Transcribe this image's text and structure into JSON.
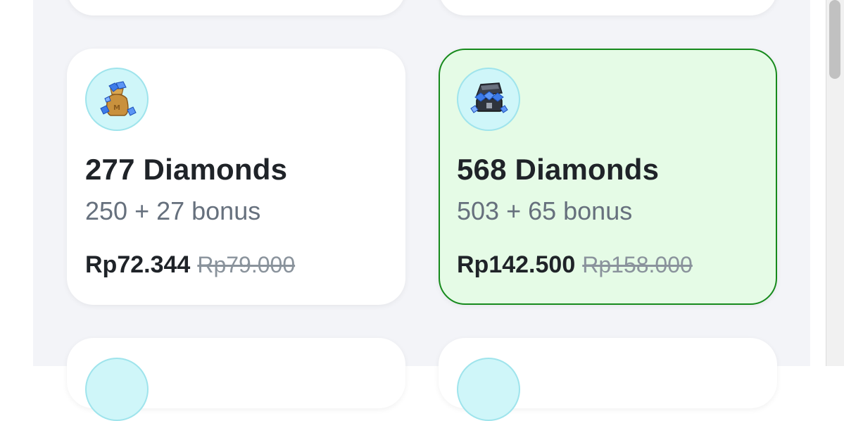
{
  "packages": [
    {
      "title": "277 Diamonds",
      "subtitle": "250 + 27 bonus",
      "price": "Rp72.344",
      "old_price": "Rp79.000",
      "icon": "diamond-bag-icon",
      "selected": false
    },
    {
      "title": "568 Diamonds",
      "subtitle": "503 + 65 bonus",
      "price": "Rp142.500",
      "old_price": "Rp158.000",
      "icon": "diamond-chest-icon",
      "selected": true
    }
  ],
  "colors": {
    "selected_border": "#168a1c",
    "selected_bg": "#e5fbe6",
    "icon_bg": "#cff6f9",
    "text_primary": "#1f2328",
    "text_secondary": "#66707d",
    "text_strike": "#8a939c"
  }
}
